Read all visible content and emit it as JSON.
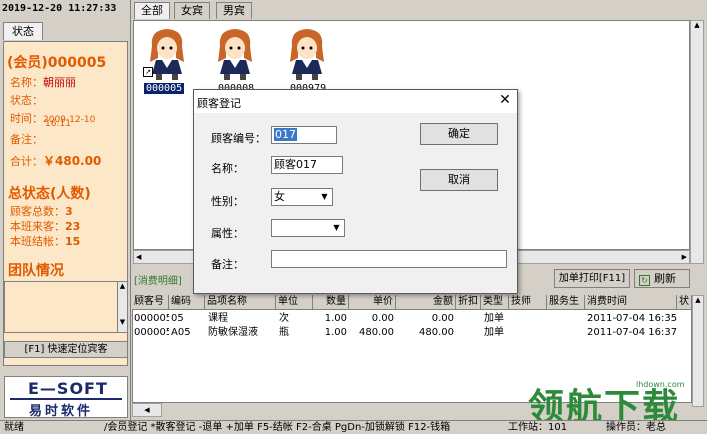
{
  "clock": "2019-12-20 11:27:33",
  "left": {
    "status_tab": "状态",
    "member_id": "(会员)000005",
    "name_label": "名称：",
    "name_value": "朝丽丽",
    "state_label": "状态：",
    "time_label": "时间：",
    "time_date": "2009-12-10",
    "time_clock": "16:11",
    "note_label": "备注：",
    "total_label": "合计：",
    "total_value": "￥480.00",
    "summary_title": "总状态(人数)",
    "guest_total_label": "顾客总数：",
    "guest_total": "3",
    "shift_in_label": "本班来客：",
    "shift_in": "23",
    "shift_out_label": "本班结帐：",
    "shift_out": "15",
    "team_title": "团队情况",
    "locate_button": "[F1] 快速定位宾客",
    "logo_top": "E—SOFT",
    "logo_bottom": "易时软件"
  },
  "tabs": [
    "全部",
    "女宾",
    "男宾"
  ],
  "guests": [
    {
      "id": "000005",
      "selected": true
    },
    {
      "id": "000008",
      "selected": false
    },
    {
      "id": "000979",
      "selected": false
    }
  ],
  "bill_bar": {
    "label": "[消费明细]",
    "print_button": "加单打印[F11]",
    "refresh_button": "刷新"
  },
  "table": {
    "headers": [
      "顾客号",
      "编码",
      "品项名称",
      "单位",
      "数量",
      "单价",
      "金额",
      "折扣",
      "类型",
      "技师",
      "服务生",
      "消费时间",
      "状"
    ],
    "rows": [
      [
        "000005",
        "05",
        "课程",
        "次",
        "1.00",
        "0.00",
        "0.00",
        "",
        "加单",
        "",
        "",
        "2011-07-04 16:35",
        ""
      ],
      [
        "000005",
        "A05",
        "防敏保湿液",
        "瓶",
        "1.00",
        "480.00",
        "480.00",
        "",
        "加单",
        "",
        "",
        "2011-07-04 16:37",
        ""
      ]
    ]
  },
  "status_bar": {
    "ready": "就绪",
    "hint": "/会员登记 *散客登记 -退单 +加单 F5-结帐 F2-合桌 PgDn-加锁解锁 F12-钱箱",
    "workstation": "工作站：101",
    "operator": "操作员：老总"
  },
  "dialog": {
    "title": "顾客登记",
    "code_label": "顾客编号：",
    "code_value": "017",
    "name_label": "名称：",
    "name_value": "顾客017",
    "gender_label": "性别：",
    "gender_value": "女",
    "attr_label": "属性：",
    "attr_value": "",
    "note_label": "备注：",
    "note_value": "",
    "ok_button": "确定",
    "cancel_button": "取消"
  },
  "watermark": {
    "big": "领航下载",
    "small": "lhdown.com"
  },
  "colors": {
    "accent_orange": "#e05a00",
    "panel_bg": "#fce8c8",
    "selection": "#0a246a",
    "logo_blue": "#1b2a6b",
    "watermark_green": "#2c8a3a"
  }
}
